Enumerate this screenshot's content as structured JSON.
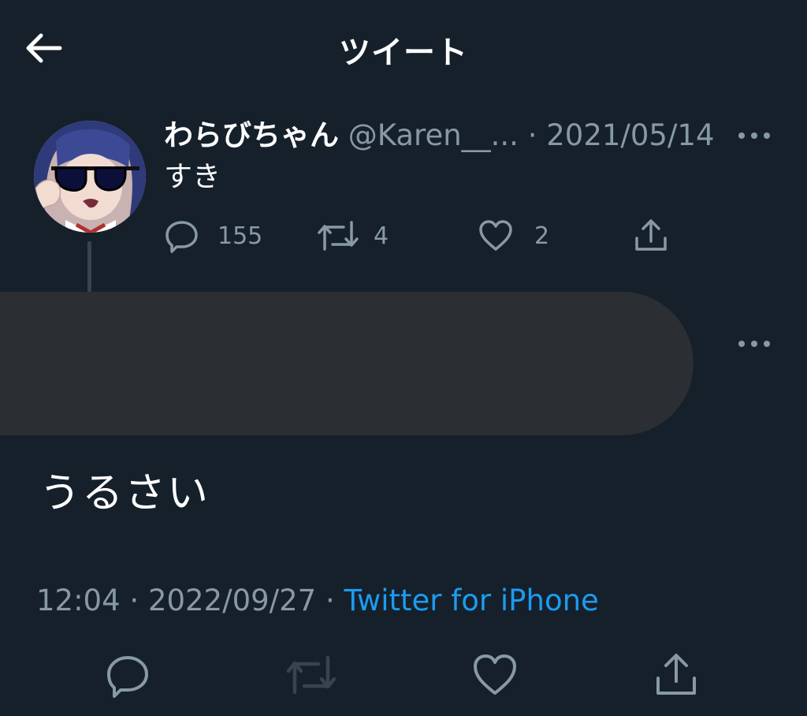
{
  "header": {
    "title": "ツイート",
    "back_icon": "arrow-left-icon"
  },
  "parent_tweet": {
    "author_name": "わらびちゃん",
    "author_handle": "@Karen__...",
    "separator": "·",
    "date": "2021/05/14",
    "text": "すき",
    "reply_count": "155",
    "retweet_count": "4",
    "like_count": "2",
    "icons": {
      "reply": "reply-icon",
      "retweet": "retweet-icon",
      "like": "heart-icon",
      "share": "share-icon",
      "more": "more-icon"
    }
  },
  "reply_tweet": {
    "text": "うるさい",
    "time": "12:04",
    "separator_1": "·",
    "date": "2022/09/27",
    "separator_2": "·",
    "source": "Twitter for iPhone"
  },
  "colors": {
    "background": "#15202b",
    "muted_text": "#8899a6",
    "link": "#1d9bf0",
    "redaction": "#2b2f33"
  }
}
